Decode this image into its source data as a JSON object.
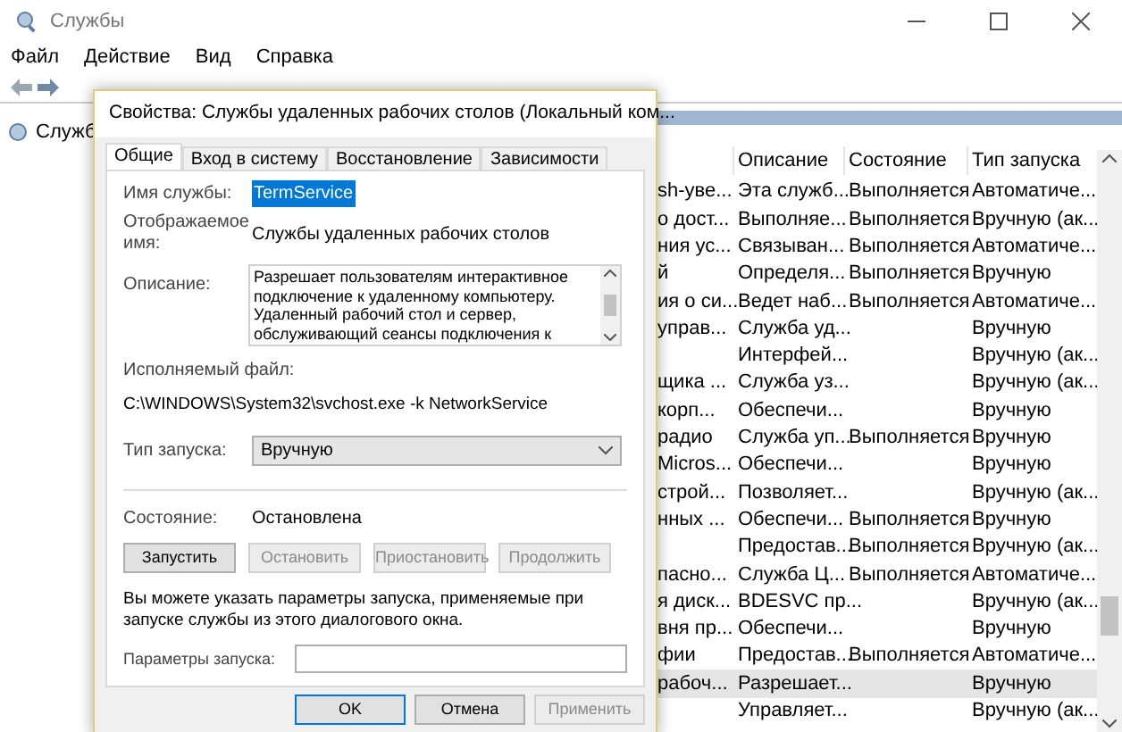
{
  "window": {
    "title": "Службы"
  },
  "menu": [
    "Файл",
    "Действие",
    "Вид",
    "Справка"
  ],
  "tree": {
    "label": "Служб"
  },
  "table": {
    "columns": [
      "Описание",
      "Состояние",
      "Тип запуска"
    ],
    "rows": [
      {
        "name": "sh-уве...",
        "description": "Эта служб...",
        "status": "Выполняется",
        "startup": "Автоматиче...",
        "selected": false
      },
      {
        "name": "о дост...",
        "description": "Выполняе...",
        "status": "Выполняется",
        "startup": "Вручную (ак...",
        "selected": false
      },
      {
        "name": "ния ус...",
        "description": "Связыван...",
        "status": "Выполняется",
        "startup": "Автоматиче...",
        "selected": false
      },
      {
        "name": "й",
        "description": "Определя...",
        "status": "Выполняется",
        "startup": "Вручную",
        "selected": false
      },
      {
        "name": "ия о си...",
        "description": "Ведет наб...",
        "status": "Выполняется",
        "startup": "Автоматиче...",
        "selected": false
      },
      {
        "name": "управ...",
        "description": "Служба уд...",
        "status": "",
        "startup": "Вручную",
        "selected": false
      },
      {
        "name": "",
        "description": "Интерфей...",
        "status": "",
        "startup": "Вручную (ак...",
        "selected": false
      },
      {
        "name": "щика ...",
        "description": "Служба уз...",
        "status": "",
        "startup": "Вручную (ак...",
        "selected": false
      },
      {
        "name": "корп...",
        "description": "Обеспечи...",
        "status": "",
        "startup": "Вручную",
        "selected": false
      },
      {
        "name": "радио",
        "description": "Служба уп...",
        "status": "Выполняется",
        "startup": "Вручную",
        "selected": false
      },
      {
        "name": "Micros...",
        "description": "Обеспечи...",
        "status": "",
        "startup": "Вручную",
        "selected": false
      },
      {
        "name": "строй...",
        "description": "Позволяет...",
        "status": "",
        "startup": "Вручную (ак...",
        "selected": false
      },
      {
        "name": "нных ...",
        "description": "Обеспечи...",
        "status": "Выполняется",
        "startup": "Вручную",
        "selected": false
      },
      {
        "name": "",
        "description": "Предостав...",
        "status": "Выполняется",
        "startup": "Вручную (ак...",
        "selected": false
      },
      {
        "name": "пасно...",
        "description": "Служба Ц...",
        "status": "Выполняется",
        "startup": "Автоматиче...",
        "selected": false
      },
      {
        "name": "я диск...",
        "description": "BDESVC пр...",
        "status": "",
        "startup": "Вручную (ак...",
        "selected": false
      },
      {
        "name": "вня пр...",
        "description": "Обеспечи...",
        "status": "",
        "startup": "Вручную",
        "selected": false
      },
      {
        "name": "фии",
        "description": "Предостав...",
        "status": "Выполняется",
        "startup": "Автоматиче...",
        "selected": false
      },
      {
        "name": "рабоч...",
        "description": "Разрешает...",
        "status": "",
        "startup": "Вручную",
        "selected": true
      },
      {
        "name": "",
        "description": "Управляет...",
        "status": "",
        "startup": "Вручную (ак...",
        "selected": false
      }
    ]
  },
  "dialog": {
    "title": "Свойства: Службы удаленных рабочих столов (Локальный ком...",
    "tabs": [
      {
        "label": "Общие",
        "selected": true
      },
      {
        "label": "Вход в систему",
        "selected": false
      },
      {
        "label": "Восстановление",
        "selected": false
      },
      {
        "label": "Зависимости",
        "selected": false
      }
    ],
    "service_name_label": "Имя службы:",
    "service_name": "TermService",
    "display_name_label": "Отображаемое имя:",
    "display_name": "Службы удаленных рабочих столов",
    "description_label": "Описание:",
    "description": "Разрешает пользователям интерактивное подключение к удаленному компьютеру. Удаленный рабочий стол и сервер, обслуживающий сеансы подключения к",
    "executable_label": "Исполняемый файл:",
    "executable": "C:\\WINDOWS\\System32\\svchost.exe -k NetworkService",
    "startup_type_label": "Тип запуска:",
    "startup_type": "Вручную",
    "status_label": "Состояние:",
    "status": "Остановлена",
    "service_buttons": [
      {
        "label": "Запустить",
        "disabled": false
      },
      {
        "label": "Остановить",
        "disabled": true
      },
      {
        "label": "Приостановить",
        "disabled": true
      },
      {
        "label": "Продолжить",
        "disabled": true
      }
    ],
    "hint": "Вы можете указать параметры запуска, применяемые при запуске службы из этого диалогового окна.",
    "params_label": "Параметры запуска:",
    "buttons": [
      {
        "label": "OK",
        "disabled": false
      },
      {
        "label": "Отмена",
        "disabled": false
      },
      {
        "label": "Применить",
        "disabled": true
      }
    ]
  }
}
